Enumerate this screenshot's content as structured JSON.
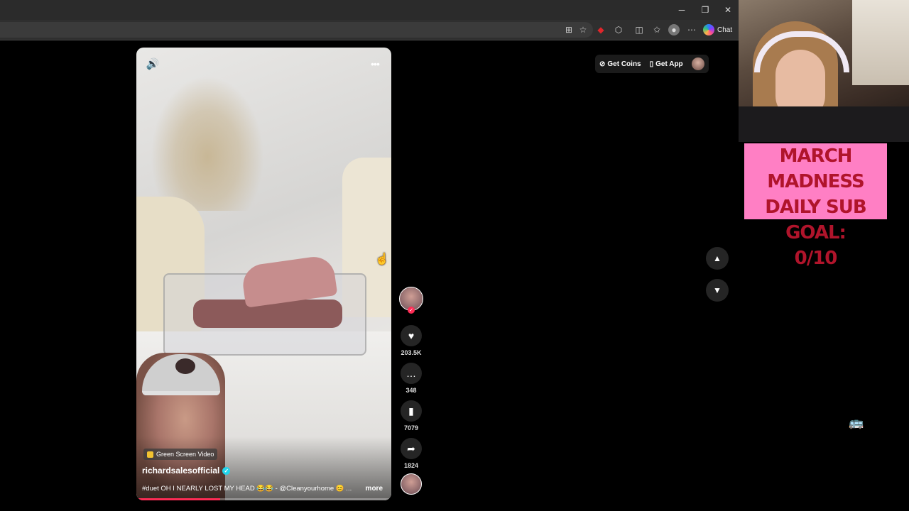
{
  "browser": {
    "window_controls": {
      "minimize": "─",
      "restore": "❐",
      "close": "✕"
    },
    "chat_label": "Chat"
  },
  "tiktok": {
    "top_right": {
      "get_coins": "Get Coins",
      "get_app": "Get App"
    },
    "video": {
      "badge": "Green Screen Video",
      "author": "richardsalesofficial",
      "caption": "#duet OH I NEARLY LOST MY HEAD 😂😂 - @Cleanyourhome 😊 ...",
      "more": "more",
      "progress_fraction": 0.33
    },
    "actions": {
      "likes": "203.5K",
      "comments": "348",
      "saves": "7079",
      "shares": "1824"
    }
  },
  "stream_overlay": {
    "sub_goal": {
      "line1": "MARCH MADNESS",
      "line2": "DAILY SUB GOAL:",
      "line3": "0/10"
    },
    "colors": {
      "goal_bg": "#ff7fc4",
      "goal_text": "#b0142b"
    }
  },
  "colors": {
    "accent": "#fe2c55",
    "verified": "#20d5ec"
  }
}
